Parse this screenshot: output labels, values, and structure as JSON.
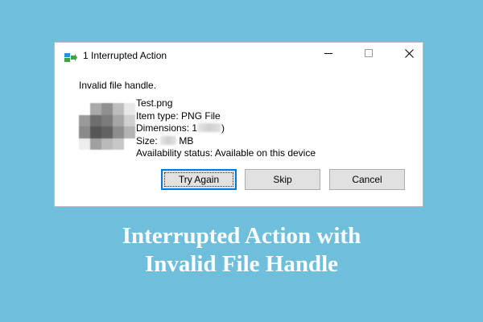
{
  "background_color": "#6fbfdc",
  "dialog": {
    "title": "1 Interrupted Action",
    "title_icon": "move-copy-icon",
    "window_controls": {
      "minimize_icon": "minimize-icon",
      "maximize_icon": "maximize-icon",
      "close_icon": "close-icon"
    },
    "message": "Invalid file handle.",
    "file": {
      "name": "Test.png",
      "item_type": "Item type: PNG File",
      "dimensions_prefix": "Dimensions: 1",
      "dimensions_tail": ")",
      "size_prefix": "Size: ",
      "size_suffix": " MB",
      "availability": "Availability status: Available on this device"
    },
    "buttons": {
      "try_again": "Try Again",
      "skip": "Skip",
      "cancel": "Cancel"
    },
    "accent_color": "#0078d7"
  },
  "caption": {
    "line1": "Interrupted Action with",
    "line2": "Invalid File Handle"
  }
}
